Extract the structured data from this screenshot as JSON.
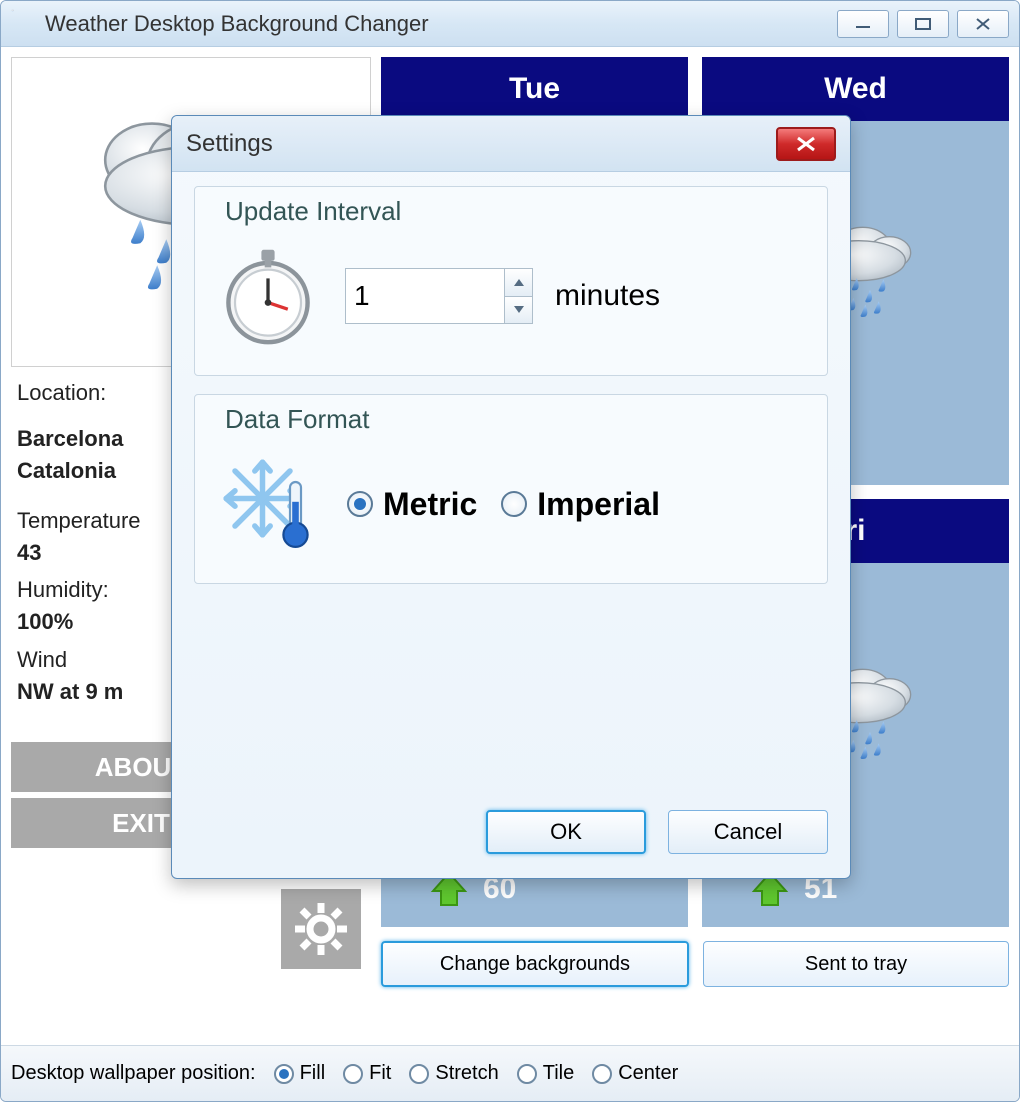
{
  "window": {
    "title": "Weather Desktop Background Changer"
  },
  "left": {
    "location_label": "Location:",
    "location_value_line1": "Barcelona",
    "location_value_line2": "Catalonia",
    "temperature_label": "Temperature",
    "temperature_value": "43",
    "humidity_label": "Humidity:",
    "humidity_value": "100%",
    "wind_label": "Wind",
    "wind_value": "NW at 9 m",
    "about_label": "ABOUT",
    "exit_label": "EXIT"
  },
  "forecast": {
    "days": [
      {
        "name": "Tue"
      },
      {
        "name": "Wed"
      },
      {
        "name": ""
      },
      {
        "name": "ri"
      }
    ],
    "hi": [
      "60",
      "51"
    ]
  },
  "buttons": {
    "change_bg": "Change backgrounds",
    "sent_tray": "Sent to tray"
  },
  "footer": {
    "label": "Desktop wallpaper position:",
    "options": [
      "Fill",
      "Fit",
      "Stretch",
      "Tile",
      "Center"
    ],
    "selected": "Fill"
  },
  "dialog": {
    "title": "Settings",
    "update_interval_legend": "Update Interval",
    "interval_value": "1",
    "interval_unit": "minutes",
    "data_format_legend": "Data Format",
    "metric_label": "Metric",
    "imperial_label": "Imperial",
    "selected_format": "Metric",
    "ok_label": "OK",
    "cancel_label": "Cancel"
  }
}
